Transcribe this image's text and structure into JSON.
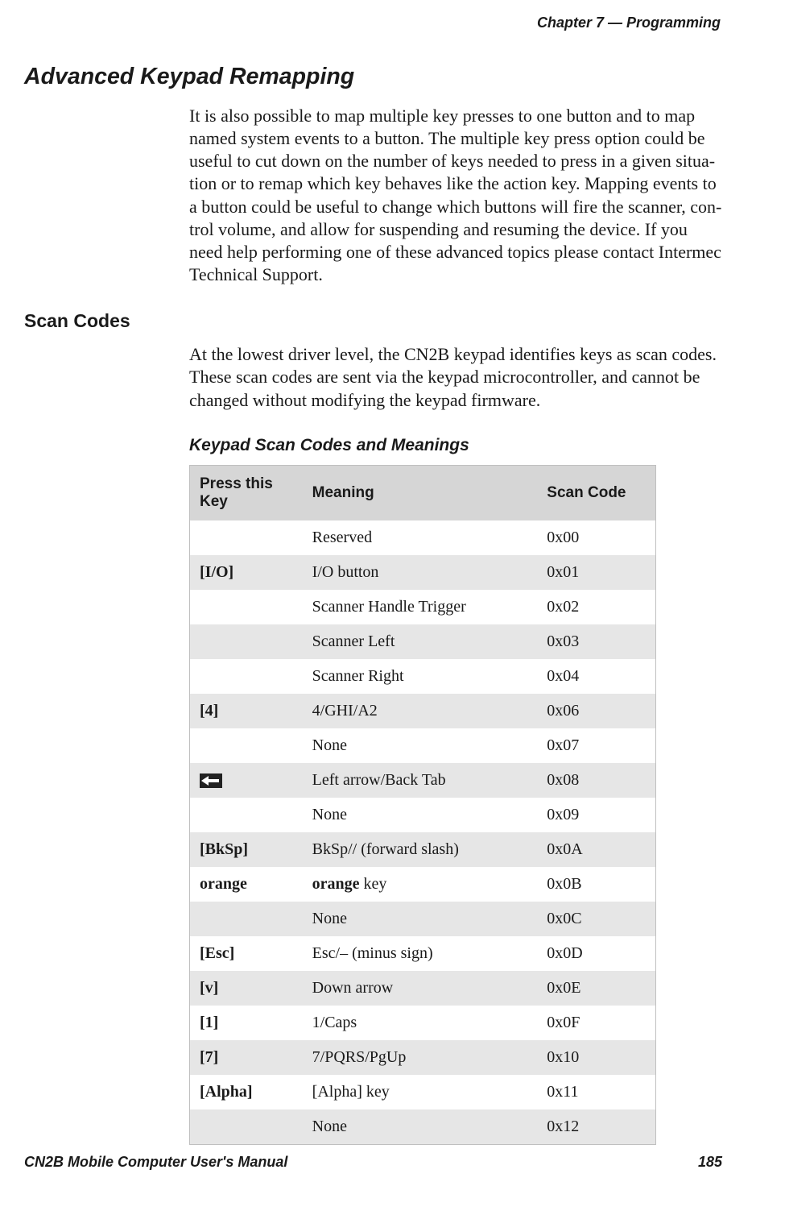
{
  "header": "Chapter 7 —  Programming",
  "sections": {
    "adv_heading": "Advanced Keypad Remapping",
    "adv_body": "It is also possible to map multiple key presses to one button and to map named system events to a button. The multiple key press option could be useful to cut down on the number of keys needed to press in a given situa-tion or to remap which key behaves like the action key. Mapping events to a button could be useful to change which buttons will fire the scanner, con-trol volume, and allow for suspending and resuming the device. If you need help performing one of these advanced topics please contact Intermec Technical Support.",
    "scan_heading": "Scan Codes",
    "scan_body": "At the lowest driver level, the CN2B keypad identifies keys as scan codes. These scan codes are sent via the keypad microcontroller, and cannot be changed without modifying the keypad firmware.",
    "table_caption": "Keypad Scan Codes and Meanings"
  },
  "table": {
    "headers": {
      "key": "Press this Key",
      "meaning": "Meaning",
      "code": "Scan Code"
    },
    "rows": [
      {
        "key": "",
        "meaning": "Reserved",
        "code": "0x00",
        "shade": "white",
        "bold": false
      },
      {
        "key": "[I/O]",
        "meaning": "I/O button",
        "code": "0x01",
        "shade": "shaded",
        "bold": true
      },
      {
        "key": "",
        "meaning": "Scanner Handle Trigger",
        "code": "0x02",
        "shade": "white",
        "bold": false
      },
      {
        "key": "",
        "meaning": "Scanner Left",
        "code": "0x03",
        "shade": "shaded",
        "bold": false
      },
      {
        "key": "",
        "meaning": "Scanner Right",
        "code": "0x04",
        "shade": "white",
        "bold": false
      },
      {
        "key": "[4]",
        "meaning": "4/GHI/A2",
        "code": "0x06",
        "shade": "shaded",
        "bold": true
      },
      {
        "key": "",
        "meaning": "None",
        "code": "0x07",
        "shade": "white",
        "bold": false
      },
      {
        "key": "__ICON__",
        "meaning": "Left arrow/Back Tab",
        "code": "0x08",
        "shade": "shaded",
        "bold": false
      },
      {
        "key": "",
        "meaning": "None",
        "code": "0x09",
        "shade": "white",
        "bold": false
      },
      {
        "key": "[BkSp]",
        "meaning": "BkSp// (forward slash)",
        "code": "0x0A",
        "shade": "shaded",
        "bold": true
      },
      {
        "key": "orange",
        "meaning_prefix_bold": "orange",
        "meaning_suffix": " key",
        "code": "0x0B",
        "shade": "white",
        "bold": true
      },
      {
        "key": "",
        "meaning": "None",
        "code": "0x0C",
        "shade": "shaded",
        "bold": false
      },
      {
        "key": "[Esc]",
        "meaning": "Esc/– (minus sign)",
        "code": "0x0D",
        "shade": "white",
        "bold": true
      },
      {
        "key": "[v]",
        "meaning": "Down arrow",
        "code": "0x0E",
        "shade": "shaded",
        "bold": true
      },
      {
        "key": "[1]",
        "meaning": "1/Caps",
        "code": "0x0F",
        "shade": "white",
        "bold": true
      },
      {
        "key": "[7]",
        "meaning": "7/PQRS/PgUp",
        "code": "0x10",
        "shade": "shaded",
        "bold": true
      },
      {
        "key": "[Alpha]",
        "meaning": "[Alpha] key",
        "code": "0x11",
        "shade": "white",
        "bold": true
      },
      {
        "key": "",
        "meaning": "None",
        "code": "0x12",
        "shade": "shaded",
        "bold": false
      }
    ]
  },
  "footer": {
    "left": "CN2B Mobile Computer User's Manual",
    "right": "185"
  }
}
